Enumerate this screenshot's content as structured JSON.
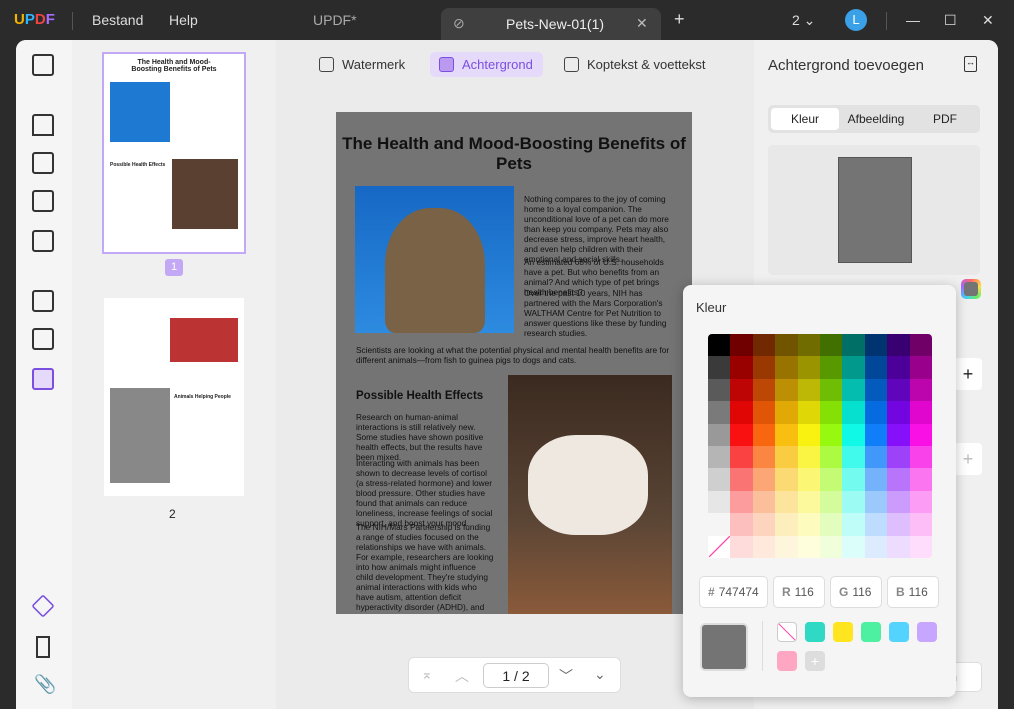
{
  "titlebar": {
    "logo": "UPDF",
    "menu": [
      "Bestand",
      "Help"
    ],
    "tabs": [
      {
        "label": "UPDF*"
      },
      {
        "label": "Pets-New-01(1)"
      }
    ],
    "window_count": "2",
    "avatar": "L"
  },
  "toolbar": {
    "items": [
      {
        "label": "Watermerk"
      },
      {
        "label": "Achtergrond",
        "active": true
      },
      {
        "label": "Koptekst & voettekst"
      }
    ]
  },
  "thumbnails": [
    {
      "page": "1",
      "title": "The Health and Mood-Boosting Benefits of Pets",
      "subtitle": "Possible Health Effects"
    },
    {
      "page": "2",
      "subtitle": "Animals Helping People"
    }
  ],
  "document": {
    "title": "The Health and Mood-Boosting Benefits of Pets",
    "para1": "Nothing compares to the joy of coming home to a loyal companion. The unconditional love of a pet can do more than keep you company. Pets may also decrease stress, improve heart health, and even help children with their emotional and social skills.",
    "para2": "An estimated 68% of U.S. households have a pet. But who benefits from an animal? And which type of pet brings health benefits?",
    "para3": "Over the past 10 years, NIH has partnered with the Mars Corporation's WALTHAM Centre for Pet Nutrition to answer questions like these by funding research studies.",
    "para4": "Scientists are looking at what the potential physical and mental health benefits are for different animals—from fish to guinea pigs to dogs and cats.",
    "heading2": "Possible Health Effects",
    "para5": "Research on human-animal interactions is still relatively new. Some studies have shown positive health effects, but the results have been mixed.",
    "para6": "Interacting with animals has been shown to decrease levels of cortisol (a stress-related hormone) and lower blood pressure. Other studies have found that animals can reduce loneliness, increase feelings of social support, and boost your mood.",
    "para7": "The NIH/Mars Partnership is funding a range of studies focused on the relationships we have with animals. For example, researchers are looking into how animals might influence child development. They're studying animal interactions with kids who have autism, attention deficit hyperactivity disorder (ADHD), and other conditions."
  },
  "pager": {
    "current": "1",
    "separator": "/",
    "total": "2"
  },
  "panel": {
    "title": "Achtergrond toevoegen",
    "tabs": [
      "Kleur",
      "Afbeelding",
      "PDF"
    ],
    "active_tab": "Kleur",
    "bottom_button": "n"
  },
  "color_picker": {
    "title": "Kleur",
    "hex": "747474",
    "r": "116",
    "g": "116",
    "b": "116",
    "current_color": "#747474",
    "recent": [
      "transparent",
      "#2fd9c4",
      "#ffe51f",
      "#4cf0a0",
      "#52d4ff",
      "#c7a6ff",
      "#ffa6c2"
    ],
    "add_label": "+"
  },
  "colors": {
    "accent": "#7b4fe0",
    "page_bg": "#747474"
  }
}
